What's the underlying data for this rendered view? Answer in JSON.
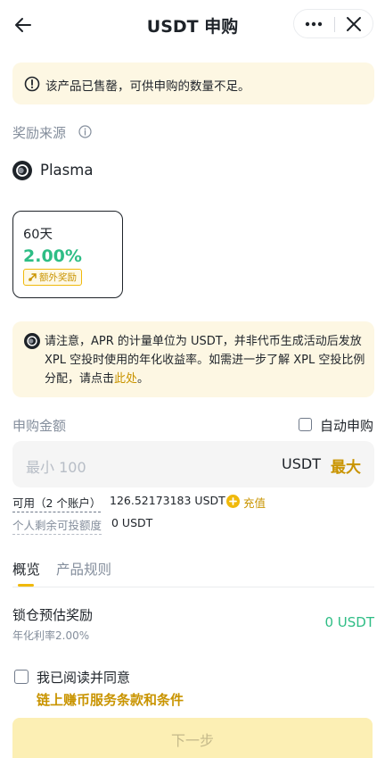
{
  "header": {
    "title": "USDT 申购",
    "back_icon": "arrow-left-icon",
    "more_icon": "more-dots-icon",
    "close_icon": "close-icon"
  },
  "alert": {
    "icon": "alert-circle-icon",
    "text": "该产品已售罄，可供申购的数量不足。"
  },
  "reward_source": {
    "label": "奖励来源",
    "info_icon": "info-circle-icon",
    "provider": "Plasma"
  },
  "term_card": {
    "days": "60天",
    "apr": "2.00%",
    "bonus_label": "额外奖励",
    "bonus_icon": "gift-icon"
  },
  "notice": {
    "text": "请注意，APR 的计量单位为 USDT，并非代币生成活动后发放 XPL 空投时使用的年化收益率。如需进一步了解 XPL 空投比例分配，请点击",
    "link": "此处",
    "suffix": "。"
  },
  "subscribe": {
    "label": "申购金额",
    "auto_label": "自动申购",
    "auto_checked": false,
    "placeholder": "最小 100",
    "unit": "USDT",
    "max_label": "最大"
  },
  "balance": {
    "available_label": "可用（2 个账户）",
    "available_value": "126.52173183 USDT",
    "topup_label": "充值",
    "remaining_label": "个人剩余可投额度",
    "remaining_value": "0 USDT"
  },
  "tabs": [
    {
      "label": "概览",
      "active": true
    },
    {
      "label": "产品规则",
      "active": false
    }
  ],
  "reward": {
    "label": "锁仓预估奖励",
    "sub": "年化利率2.00%",
    "value": "0 USDT"
  },
  "agreement": {
    "checked": false,
    "text": "我已阅读并同意",
    "link": "链上赚币服务条款和条件"
  },
  "next_button": {
    "label": "下一步",
    "enabled": false
  },
  "colors": {
    "accent": "#f0b90b",
    "link": "#c99400",
    "positive": "#2ebd85",
    "notice_bg": "#fdf7e3"
  }
}
